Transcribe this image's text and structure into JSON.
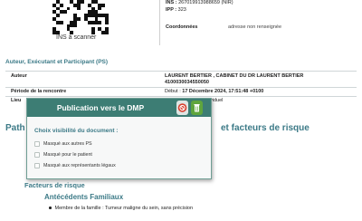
{
  "patient": {
    "ins_caption": "INS à scanner",
    "ins_label": "INS :",
    "ins_value": "267019913988659 (NIR)",
    "ipp_label": "IPP :",
    "ipp_value": "323",
    "coordonnees_label": "Coordonnées",
    "coordonnees_value": "adresse non renseignée"
  },
  "auteur_section": {
    "title": "Auteur, Exécutant et Participant (PS)",
    "rows": [
      {
        "label": "Auteur",
        "value_line1": "LAURENT BERTIER , CABINET DU DR LAURENT BERTIER",
        "value_line2": "410003003455005​0"
      },
      {
        "label": "Période de la rencontre",
        "value_prefix": "Début :",
        "value": "17 Décembre 2024, 17:51:48 +0100"
      },
      {
        "label": "Lieu",
        "value": "viduel"
      }
    ]
  },
  "body": {
    "path_heading_left": "Path",
    "path_heading_right": "et facteurs de risque",
    "facteurs_title": "Facteurs de risque",
    "antecedents_title": "Antécédents Familiaux",
    "member_text": "Membre de la famille : Tumeur maligne du sein, sans précision"
  },
  "dialog": {
    "title": "Publication vers le DMP",
    "choix_label": "Choix visibilité du document :",
    "options": [
      "Masqué aux autres PS",
      "Masqué pour le patient",
      "Masqué aux représentants légaux"
    ],
    "icons": [
      "cancel-icon",
      "confirm-icon"
    ],
    "colors": {
      "header": "#3d7d74",
      "confirm": "#5fa53d",
      "cancel": "#d9402f",
      "accent": "#3c7a87"
    }
  }
}
